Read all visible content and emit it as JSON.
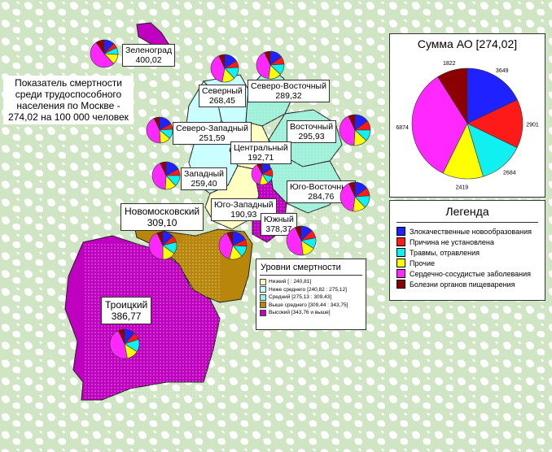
{
  "title": "Показатель смертности среди трудоспособного населения по Москве - 274,02 на 100 000 человек",
  "colors": {
    "background_green": "#cfe5c4",
    "forest_light": "#ffffff",
    "level_low": "#ffffc0",
    "level_below": "#c8ffff",
    "level_mid": "#9ff0d8",
    "level_above": "#b8860b",
    "level_high": "#c000c0"
  },
  "causes": [
    {
      "name": "Злокачественные новообразования",
      "color": "#1f22ff"
    },
    {
      "name": "Причина не установлена",
      "color": "#ff1a1a"
    },
    {
      "name": "Травмы, отравления",
      "color": "#11f0f0"
    },
    {
      "name": "Прочие",
      "color": "#ffff00"
    },
    {
      "name": "Сердечно-сосудистые заболевания",
      "color": "#ff28ff"
    },
    {
      "name": "Болезни органов пищеварения",
      "color": "#8b0000"
    }
  ],
  "districts": [
    {
      "name": "Зеленоград",
      "value": "400,02",
      "level": "Высокий",
      "shares": [
        12,
        6,
        8,
        12,
        52,
        10
      ]
    },
    {
      "name": "Северный",
      "value": "268,45",
      "level": "Ниже среднего",
      "shares": [
        16,
        8,
        14,
        15,
        40,
        7
      ]
    },
    {
      "name": "Северо-Восточный",
      "value": "289,32",
      "level": "Средний",
      "shares": [
        15,
        9,
        13,
        15,
        41,
        7
      ]
    },
    {
      "name": "Северо-Западный",
      "value": "251,59",
      "level": "Ниже среднего",
      "shares": [
        17,
        7,
        12,
        13,
        44,
        7
      ]
    },
    {
      "name": "Восточный",
      "value": "295,93",
      "level": "Средний",
      "shares": [
        15,
        10,
        12,
        14,
        42,
        7
      ]
    },
    {
      "name": "Центральный",
      "value": "192,71",
      "level": "Низкий",
      "shares": [
        17,
        12,
        12,
        13,
        38,
        8
      ]
    },
    {
      "name": "Западный",
      "value": "259,40",
      "level": "Ниже среднего",
      "shares": [
        17,
        8,
        13,
        13,
        42,
        7
      ]
    },
    {
      "name": "Юго-Восточный",
      "value": "284,76",
      "level": "Средний",
      "shares": [
        15,
        9,
        14,
        14,
        41,
        7
      ]
    },
    {
      "name": "Новомосковский",
      "value": "309,10",
      "level": "Выше среднего",
      "shares": [
        13,
        8,
        14,
        15,
        43,
        7
      ]
    },
    {
      "name": "Юго-Западный",
      "value": "190,93",
      "level": "Низкий",
      "shares": [
        18,
        8,
        13,
        15,
        39,
        7
      ]
    },
    {
      "name": "Южный",
      "value": "378,37",
      "level": "Высокий",
      "shares": [
        13,
        9,
        12,
        14,
        45,
        7
      ]
    },
    {
      "name": "Троицкий",
      "value": "386,77",
      "level": "Высокий",
      "shares": [
        12,
        8,
        14,
        13,
        46,
        7
      ]
    }
  ],
  "total_panel": {
    "title": "Сумма АО [274,02]",
    "labels": [
      "3649",
      "2901",
      "2684",
      "2419",
      "6874",
      "1822"
    ]
  },
  "legend": {
    "title": "Легенда"
  },
  "levels": {
    "title": "Уровни смертности",
    "items": [
      {
        "label": "Низкий [ : 240,81]",
        "color": "#ffffc0"
      },
      {
        "label": "Ниже среднего [240,82 : 275,12]",
        "color": "#c8ffff"
      },
      {
        "label": "Средний [275,13 : 309,43]",
        "color": "#9ff0d8"
      },
      {
        "label": "Выше среднего [309,44 : 343,75]",
        "color": "#b8860b"
      },
      {
        "label": "Высокий [343,76 и выше]",
        "color": "#c000c0"
      }
    ]
  }
}
